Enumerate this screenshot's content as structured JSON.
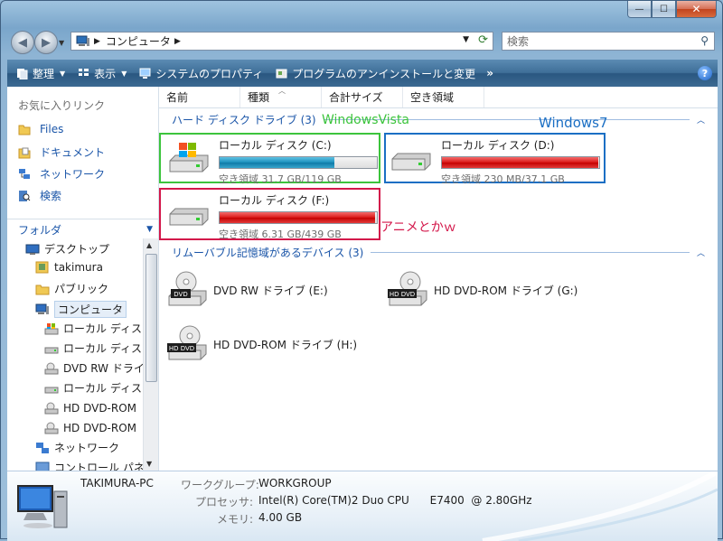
{
  "window": {
    "caption": {
      "minimize": "—",
      "maximize": "☐",
      "close": "✕"
    }
  },
  "address_bar": {
    "crumb": "コンピュータ",
    "search_placeholder": "検索"
  },
  "command_bar": {
    "organize": "整理",
    "views": "表示",
    "system_properties": "システムのプロパティ",
    "uninstall": "プログラムのアンインストールと変更",
    "more": "»",
    "help": "?"
  },
  "nav_pane": {
    "favorites_title": "お気に入りリンク",
    "favorites": [
      {
        "label": "Files",
        "icon": "folder-icon"
      },
      {
        "label": "ドキュメント",
        "icon": "documents-icon"
      },
      {
        "label": "ネットワーク",
        "icon": "network-icon"
      },
      {
        "label": "検索",
        "icon": "search-folder-icon"
      }
    ],
    "folders_title": "フォルダ",
    "tree": [
      {
        "label": "デスクトップ",
        "icon": "desktop-icon",
        "indent": 0
      },
      {
        "label": "takimura",
        "icon": "user-folder-icon",
        "indent": 1
      },
      {
        "label": "パブリック",
        "icon": "folder-icon",
        "indent": 1
      },
      {
        "label": "コンピュータ",
        "icon": "computer-icon",
        "indent": 1,
        "selected": true
      },
      {
        "label": "ローカル ディスク (C:)",
        "icon": "windows-drive-icon",
        "indent": 2
      },
      {
        "label": "ローカル ディスク (D:)",
        "icon": "drive-icon",
        "indent": 2
      },
      {
        "label": "DVD RW ドライブ (E:)",
        "icon": "dvd-drive-icon",
        "indent": 2
      },
      {
        "label": "ローカル ディスク (F:)",
        "icon": "drive-icon",
        "indent": 2
      },
      {
        "label": "HD DVD-ROM ドライブ (G:)",
        "icon": "dvd-drive-icon",
        "indent": 2
      },
      {
        "label": "HD DVD-ROM ドライブ (H:)",
        "icon": "dvd-drive-icon",
        "indent": 2
      },
      {
        "label": "ネットワーク",
        "icon": "network-icon",
        "indent": 1
      },
      {
        "label": "コントロール パネル",
        "icon": "control-panel-icon",
        "indent": 1
      }
    ]
  },
  "columns": [
    "名前",
    "種類",
    "合計サイズ",
    "空き領域"
  ],
  "hard_disks": {
    "group_title": "ハード ディスク ドライブ (3)",
    "drives": [
      {
        "name": "ローカル ディスク (C:)",
        "free": "空き領域 31.7 GB/119 GB",
        "used_fraction": 0.73,
        "bar_color": "blue",
        "os": true
      },
      {
        "name": "ローカル ディスク (D:)",
        "free": "空き領域 230 MB/37.1 GB",
        "used_fraction": 0.994,
        "bar_color": "red",
        "os": false
      },
      {
        "name": "ローカル ディスク (F:)",
        "free": "空き領域 6.31 GB/439 GB",
        "used_fraction": 0.986,
        "bar_color": "red",
        "os": false
      }
    ]
  },
  "annotations": {
    "c_label": "WindowsVista",
    "d_label": "Windows7",
    "f_label": "アニメとかｗ",
    "colors": {
      "green": "#3cc43c",
      "blue": "#1b6fc4",
      "red": "#d3174a"
    }
  },
  "removable": {
    "group_title": "リムーバブル記憶域があるデバイス (3)",
    "devices": [
      {
        "name": "DVD RW ドライブ (E:)",
        "badge": "DVD"
      },
      {
        "name": "HD DVD-ROM ドライブ (G:)",
        "badge": "HD DVD"
      },
      {
        "name": "HD DVD-ROM ドライブ (H:)",
        "badge": "HD DVD"
      }
    ]
  },
  "details": {
    "pc_name": "TAKIMURA-PC",
    "workgroup_label": "ワークグループ:",
    "workgroup": "WORKGROUP",
    "processor_label": "プロセッサ:",
    "processor": "Intel(R) Core(TM)2 Duo CPU      E7400  @ 2.80GHz",
    "memory_label": "メモリ:",
    "memory": "4.00 GB"
  }
}
